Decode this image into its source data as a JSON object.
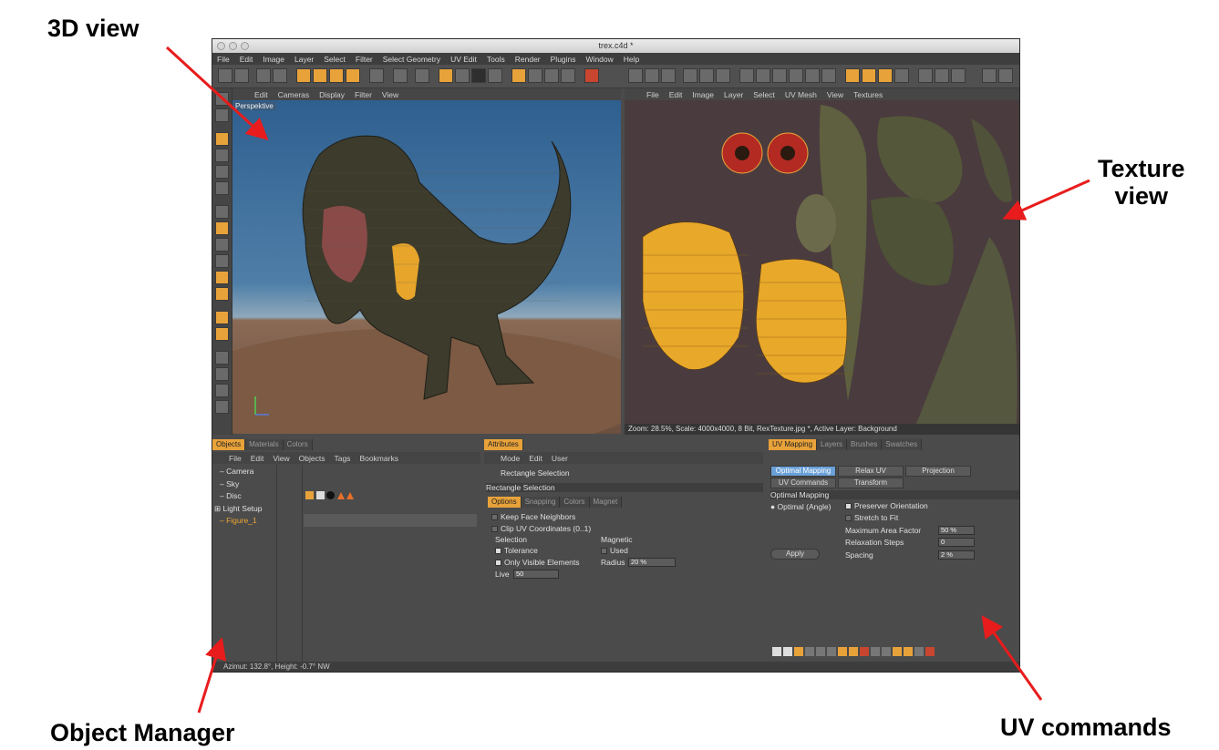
{
  "callouts": {
    "view3d": "3D view",
    "texture": "Texture\nview",
    "object_manager": "Object Manager",
    "uv_commands": "UV commands"
  },
  "window": {
    "title": "trex.c4d *"
  },
  "menubar": [
    "File",
    "Edit",
    "Image",
    "Layer",
    "Select",
    "Filter",
    "Select Geometry",
    "UV Edit",
    "Tools",
    "Render",
    "Plugins",
    "Window",
    "Help"
  ],
  "viewport3d": {
    "menu": [
      "Edit",
      "Cameras",
      "Display",
      "Filter",
      "View"
    ],
    "label": "Perspektive"
  },
  "texview": {
    "menu": [
      "File",
      "Edit",
      "Image",
      "Layer",
      "Select",
      "UV Mesh",
      "View",
      "Textures"
    ],
    "status": "Zoom: 28.5%, Scale: 4000x4000, 8 Bit, RexTexture.jpg *, Active Layer: Background"
  },
  "objects_panel": {
    "tabs": [
      "Objects",
      "Materials",
      "Colors"
    ],
    "menu": [
      "File",
      "Edit",
      "View",
      "Objects",
      "Tags",
      "Bookmarks"
    ],
    "items": [
      "Camera",
      "Sky",
      "Disc",
      "Light Setup",
      "Figure_1"
    ]
  },
  "attributes": {
    "tab": "Attributes",
    "menu": [
      "Mode",
      "Edit",
      "User"
    ],
    "tool_name": "Rectangle Selection",
    "section_title": "Rectangle Selection",
    "subtabs": [
      "Options",
      "Snapping",
      "Colors",
      "Magnet"
    ],
    "keep_face_neighbors": "Keep Face Neighbors",
    "clip_uv": "Clip UV Coordinates (0..1)",
    "selection_label": "Selection",
    "tolerance": "Tolerance",
    "only_visible": "Only Visible Elements",
    "live_label": "Live",
    "live_value": "50",
    "magnetic_label": "Magnetic",
    "used": "Used",
    "radius_label": "Radius",
    "radius_value": "20 %"
  },
  "uv_panel": {
    "tabs": [
      "UV Mapping",
      "Layers",
      "Brushes",
      "Swatches"
    ],
    "buttons_row1": [
      "Optimal Mapping",
      "Relax UV",
      "Projection"
    ],
    "buttons_row2": [
      "UV Commands",
      "Transform"
    ],
    "section_title": "Optimal Mapping",
    "mode": "Optimal (Angle)",
    "preserve": "Preserver Orientation",
    "stretch": "Stretch to Fit",
    "max_area_label": "Maximum Area Factor",
    "max_area_value": "50 %",
    "relax_label": "Relaxation Steps",
    "relax_value": "0",
    "spacing_label": "Spacing",
    "spacing_value": "2 %",
    "apply": "Apply"
  },
  "statusbar": "Azimut: 132.8°, Height: -0.7° NW",
  "colors": {
    "accent": "#e8a23a",
    "arrow": "#e81c1c"
  }
}
